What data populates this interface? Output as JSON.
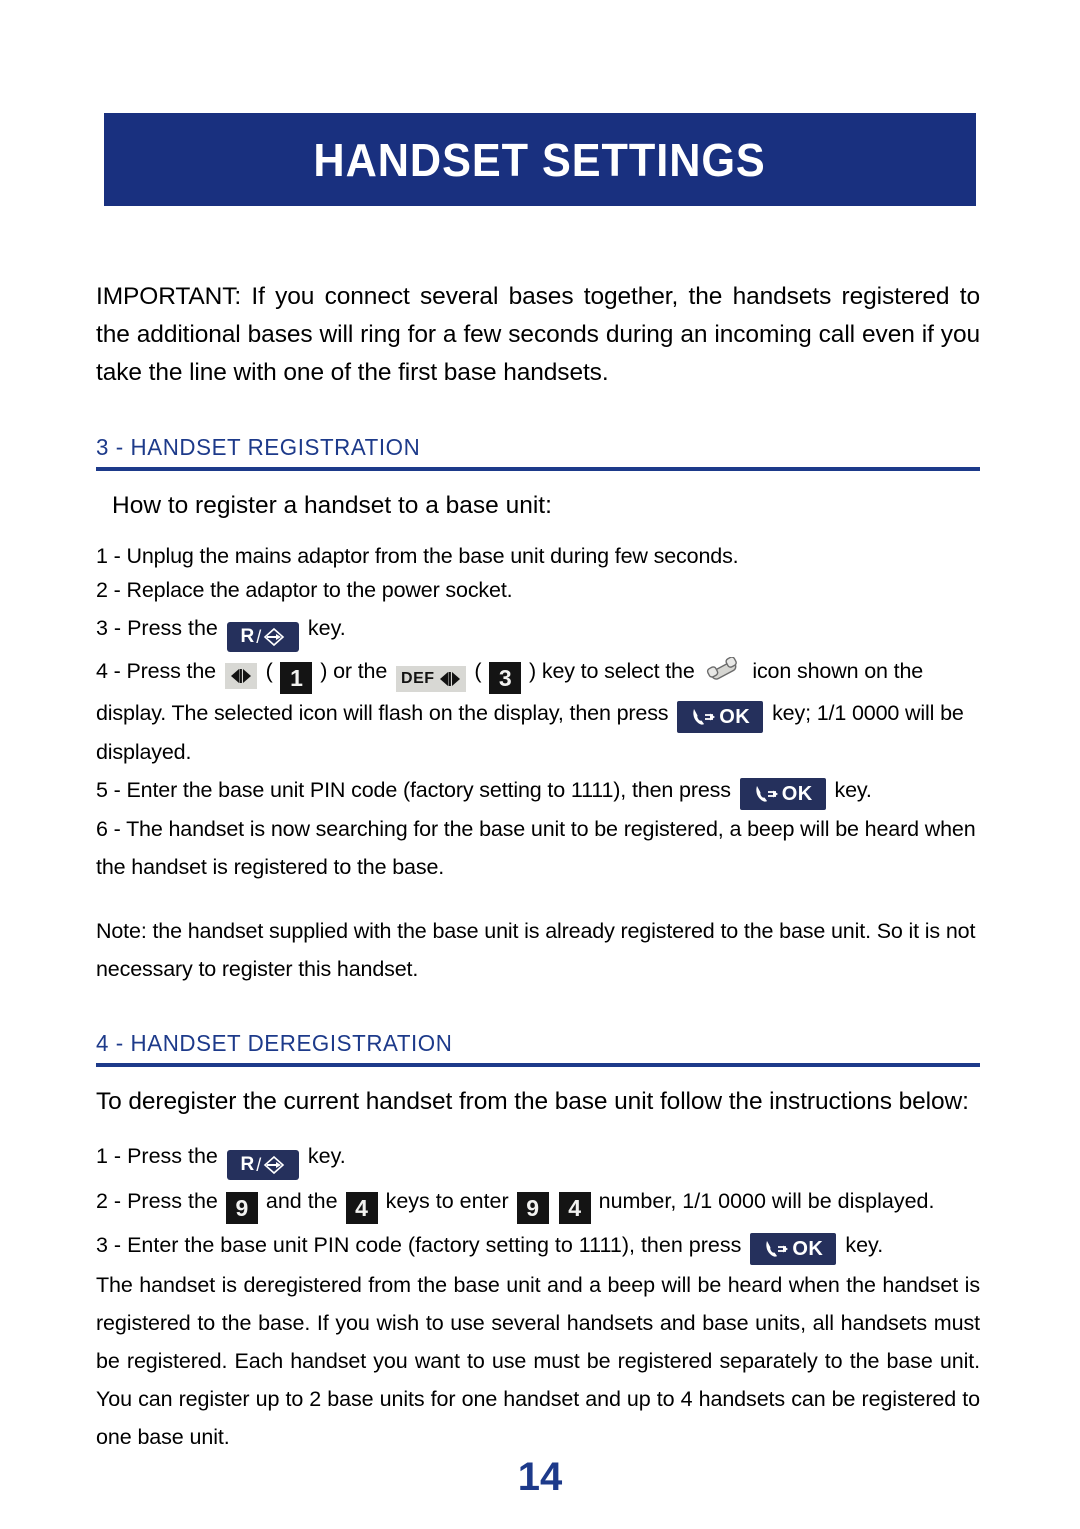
{
  "document": {
    "banner_title": "HANDSET SETTINGS",
    "page_number": "14",
    "colors": {
      "banner_background": "#19307f",
      "heading_blue": "#1d3a8a",
      "key_navy": "#25305c",
      "key_black": "#141414",
      "key_gray": "#d8d8d4"
    }
  },
  "important_note": {
    "text": "IMPORTANT: If you connect several bases together, the handsets registered to the additional bases will ring for a few seconds during an incoming call even if you take the line with one of the first base handsets."
  },
  "section_registration": {
    "heading": "3 -  HANDSET REGISTRATION",
    "subhead": "How to register a handset to a base unit:",
    "step1": "1 - Unplug the mains adaptor from the base unit during few seconds.",
    "step2": "2 - Replace the adaptor to the power socket.",
    "step3_before": "3 - Press the",
    "step3_after": "key.",
    "step4_a": "4 - Press the",
    "step4_b": "(",
    "step4_c": ") or the",
    "step4_d": "(",
    "step4_e": ") key to select the",
    "step4_f": "icon shown on the",
    "step4_g": "display. The selected icon will flash on the display, then press",
    "step4_h": "key; 1/1 0000 will be displayed.",
    "step5_before": "5 -  Enter the base unit PIN code  (factory setting to 1111), then  press",
    "step5_after": "key.",
    "step6": "6 - The handset is now searching for the base unit to be registered, a beep will be heard when the handset is registered to the base.",
    "note": "Note: the handset supplied with the base unit is already registered to the base unit. So it is not necessary to register this handset.",
    "keys": {
      "r_key_letter": "R",
      "r_key_slash": "/",
      "num_one": "1",
      "num_three": "3",
      "def_label": "DEF",
      "ok_label": "OK"
    }
  },
  "section_deregistration": {
    "heading": "4 -  HANDSET DEREGISTRATION",
    "intro": "To deregister the current handset from the base unit follow the instructions below:",
    "step1_before": "1 - Press the",
    "step1_after": "key.",
    "step2_a": "2 - Press the",
    "step2_b": "and the",
    "step2_c": "keys to enter",
    "step2_d": "number, 1/1 0000 will be displayed.",
    "step3_before": "3 - Enter the base unit PIN code  (factory setting to 1111), then  press",
    "step3_after": "key.",
    "closing": "The handset is deregistered from the base unit and a beep will be heard when the handset is registered to the base. If you wish to use several handsets and base units, all handsets must be registered. Each handset you want to use must be registered separately to the base unit. You can register up to 2 base units for one handset and up to 4 handsets can be registered to one base unit.",
    "keys": {
      "num_nine": "9",
      "num_four": "4",
      "ok_label": "OK",
      "r_key_letter": "R",
      "r_key_slash": "/"
    }
  }
}
